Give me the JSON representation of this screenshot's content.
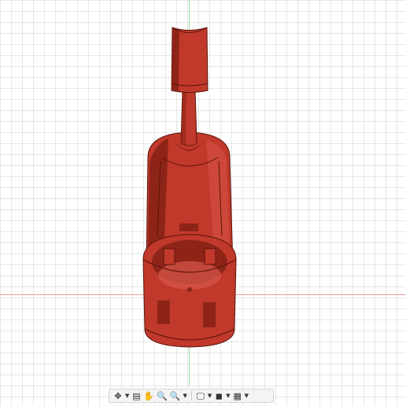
{
  "colors": {
    "model": "#c0392b",
    "model_dark": "#8e2418",
    "model_light": "#d9584a",
    "edge": "#5a140c",
    "axis_x": "#e8a0a0",
    "axis_y": "#9fdf9f",
    "grid": "#cfcfcf"
  },
  "toolbar": {
    "items": [
      {
        "name": "orbit-icon",
        "glyph": "✥",
        "has_caret": true
      },
      {
        "name": "look-at-icon",
        "glyph": "▤",
        "has_caret": false
      },
      {
        "name": "pan-hand-icon",
        "glyph": "✋",
        "has_caret": false
      },
      {
        "name": "zoom-icon",
        "glyph": "🔍",
        "has_caret": false
      },
      {
        "name": "zoom-window-icon",
        "glyph": "🔍",
        "has_caret": true
      },
      {
        "name": "display-settings-icon",
        "glyph": "🖵",
        "has_caret": true
      },
      {
        "name": "visual-style-icon",
        "glyph": "◼",
        "has_caret": true
      },
      {
        "name": "grid-settings-icon",
        "glyph": "▦",
        "has_caret": true
      }
    ]
  }
}
